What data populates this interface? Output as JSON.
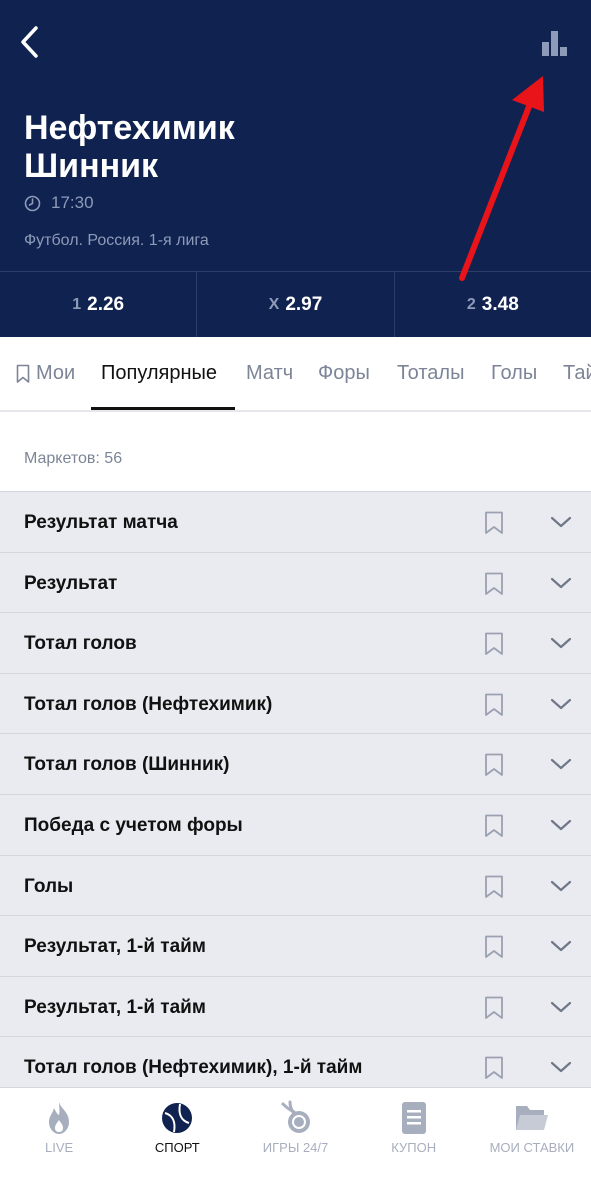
{
  "header": {
    "team1": "Нефтехимик",
    "team2": "Шинник",
    "time": "17:30",
    "league": "Футбол. Россия. 1-я лига",
    "odds": [
      {
        "label": "1",
        "value": "2.26"
      },
      {
        "label": "X",
        "value": "2.97"
      },
      {
        "label": "2",
        "value": "3.48"
      }
    ]
  },
  "tabs": [
    {
      "label": "Мои",
      "icon": "bookmark-icon"
    },
    {
      "label": "Популярные",
      "active": true
    },
    {
      "label": "Матч"
    },
    {
      "label": "Форы"
    },
    {
      "label": "Тоталы"
    },
    {
      "label": "Голы"
    },
    {
      "label": "Тай"
    }
  ],
  "markets_count": "Маркетов: 56",
  "markets": [
    "Результат матча",
    "Результат",
    "Тотал голов",
    "Тотал голов (Нефтехимик)",
    "Тотал голов (Шинник)",
    "Победа с учетом форы",
    "Голы",
    "Результат, 1-й тайм",
    "Результат, 1-й тайм",
    "Тотал голов (Нефтехимик), 1-й тайм"
  ],
  "bottom_nav": [
    {
      "label": "LIVE",
      "icon": "flame-icon"
    },
    {
      "label": "СПОРТ",
      "icon": "ball-icon",
      "active": true
    },
    {
      "label": "ИГРЫ 24/7",
      "icon": "games-icon"
    },
    {
      "label": "КУПОН",
      "icon": "coupon-icon"
    },
    {
      "label": "МОИ СТАВКИ",
      "icon": "folder-icon"
    }
  ],
  "colors": {
    "header_bg": "#0f2250",
    "list_bg": "#e9ebf0",
    "annotation_arrow": "#e8141a",
    "muted_text": "#8e9bb8"
  }
}
